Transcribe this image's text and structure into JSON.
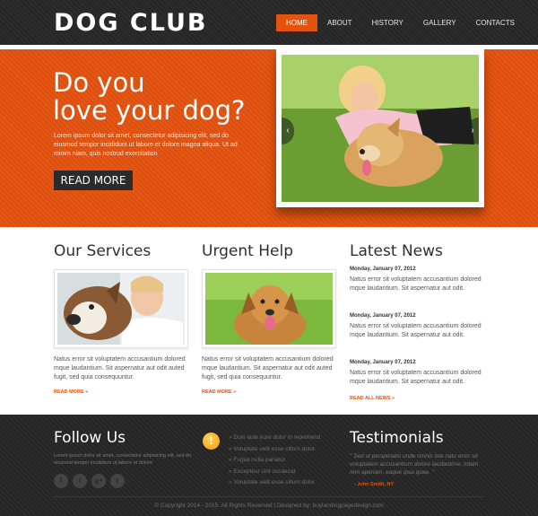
{
  "brand": {
    "logo": "DOG CLUB",
    "accent": "#e3520e"
  },
  "nav": {
    "items": [
      {
        "label": "HOME",
        "active": true
      },
      {
        "label": "ABOUT"
      },
      {
        "label": "HISTORY"
      },
      {
        "label": "GALLERY"
      },
      {
        "label": "CONTACTS"
      }
    ]
  },
  "hero": {
    "title_line1": "Do you",
    "title_line2": "love your dog?",
    "text": "Lorem ipsum dolor sit amet, consectetur adipisicing elit, sed do eiusmod tempor incididunt ut labore et dolore magna aliqua. Ut ad minim niam, quis nostrud exercitation",
    "button_label": "READ MORE",
    "prev_arrow": "‹",
    "next_arrow": "›"
  },
  "services": {
    "title": "Our Services",
    "text": "Natus error sit voluptatem accusantium dolored mque laudantium. Sit aspernatur aut odit auted fugit, sed quia consequuntur.",
    "link": "READ MORE »"
  },
  "urgent": {
    "title": "Urgent Help",
    "text": "Natus error sit voluptatem accusantium dolored mque laudantium. Sit aspernatur aut odit auted fugit, sed quia consequuntur.",
    "link": "READ MORE »"
  },
  "news": {
    "title": "Latest News",
    "items": [
      {
        "date": "Monday, January 07, 2012",
        "text": "Natus error sit voluptatem accusantium dolored mque laudantium. Sit aspernatur aut odit."
      },
      {
        "date": "Monday, January 07, 2012",
        "text": "Natus error sit voluptatem accusantium dolored mque laudantium. Sit aspernatur aut odit."
      },
      {
        "date": "Monday, January 07, 2012",
        "text": "Natus error sit voluptatem accusantium dolored mque laudantium. Sit aspernatur aut odit."
      }
    ],
    "link": "READ ALL NEWS »"
  },
  "footer": {
    "follow_title": "Follow Us",
    "follow_text": "Lorem ipsum dolor sit amet, consectetur adipisicing elit, sed do eiusmod tempor incididunt ut labore et dolore",
    "social": [
      {
        "icon": "facebook-icon",
        "glyph": "f"
      },
      {
        "icon": "twitter-icon",
        "glyph": "t"
      },
      {
        "icon": "google-plus-icon",
        "glyph": "g+"
      },
      {
        "icon": "rss-icon",
        "glyph": "r"
      }
    ],
    "alert_glyph": "!",
    "links": [
      "Duis aute irure dolor in reprehend",
      "Voluptate velit esse cillum dolor.",
      "Fugiat nulla pariatur.",
      "Excepteur sint occaecat",
      "Voluptate velit esse cillum dolor"
    ],
    "testimonials_title": "Testimonials",
    "testimonial_text": "\" Sed ut perspiciatis unde omnis iste natu error sit voluptatem accusantium dolore laudantime, totam rem aperiam, eaque ipsa quae. \"",
    "testimonial_author": "- John Smith, NY",
    "copyright": "© Copyright 2014 - 2015. All Rights Reserved | Designed by: buylandingpagedesign.com"
  }
}
